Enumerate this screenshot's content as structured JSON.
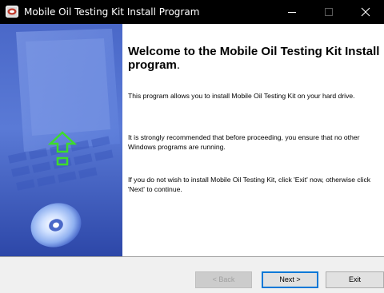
{
  "window": {
    "title": "Mobile Oil Testing Kit Install Program"
  },
  "content": {
    "heading": "Welcome to the Mobile Oil Testing Kit Install program",
    "heading_end": ".",
    "paragraph1": "This program allows you to install Mobile Oil Testing Kit on your hard drive.",
    "paragraph2": "It is strongly recommended that before proceeding, you ensure that no other Windows programs are running.",
    "paragraph3": "If you do not wish to install Mobile Oil Testing Kit, click 'Exit' now, otherwise click 'Next' to continue."
  },
  "buttons": {
    "back_label": "< Back",
    "next_label": "Next >",
    "exit_label": "Exit"
  },
  "icons": {
    "app": "installer-icon",
    "arrow": "upload-arrow-icon",
    "disc": "cd-disc-icon"
  },
  "colors": {
    "titlebar": "#000000",
    "panel_blue": "#4f6fd0",
    "arrow_green": "#3ddc2a",
    "focus_border": "#0078d7"
  }
}
